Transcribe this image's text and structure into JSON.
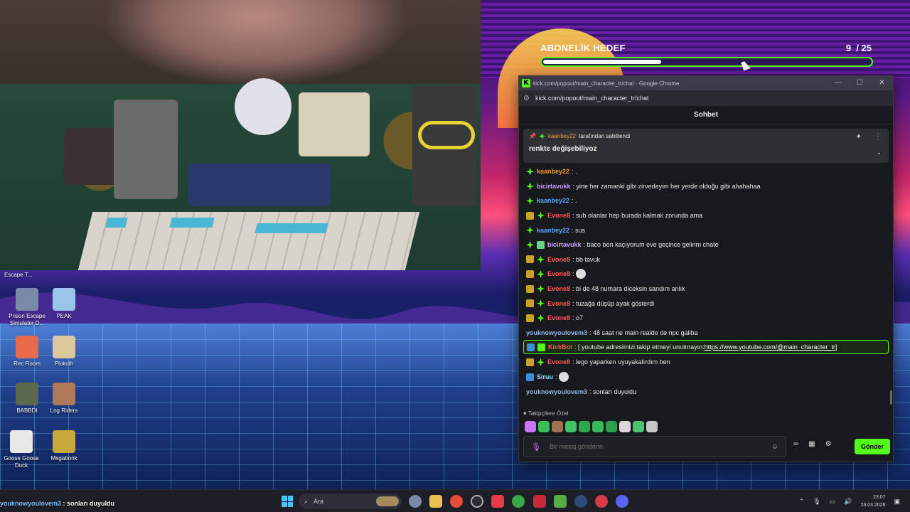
{
  "goal": {
    "title": "ABONELİK HEDEF",
    "current": "9",
    "total": "/ 25",
    "progress": 0.36
  },
  "desktop": {
    "top_label": "Escape T...",
    "icons": [
      {
        "label": "Prison Escape Simulator D...",
        "color": "#7a8aa8"
      },
      {
        "label": "PEAK",
        "color": "#9ac4e8"
      },
      {
        "label": "Rec Room",
        "color": "#e86a4a"
      },
      {
        "label": "Plokoth",
        "color": "#d8c89a"
      },
      {
        "label": "BABBDI",
        "color": "#5a6a4a"
      },
      {
        "label": "Log Riders",
        "color": "#b07a5a"
      },
      {
        "label": "Goose Goose Duck",
        "color": "#e8e8e8"
      },
      {
        "label": "Megabonk",
        "color": "#c8a83a"
      }
    ]
  },
  "window": {
    "title": "kick.com/popout/main_character_tr/chat - Google Chrome",
    "url": "kick.com/popout/main_character_tr/chat",
    "minimize": "—",
    "maximize": "☐",
    "close": "✕"
  },
  "chat": {
    "header": "Sohbet",
    "pinned": {
      "by_user": "kaanbey22",
      "by_text": "tarafından sabitlendi",
      "message": "renkte değişebiliyoz"
    },
    "messages": [
      {
        "user": "kaanbey22",
        "text": ": .",
        "color": "#f29a38",
        "badges": [
          "sub"
        ]
      },
      {
        "user": "bicirtavukk",
        "text": ": yine her zamanki gibi zirvedeyim her yerde olduğu gibi ahahahaa",
        "color": "#c9a0ff",
        "badges": [
          "sub"
        ]
      },
      {
        "user": "kaanbey22",
        "text": ": .",
        "color": "#5aa9ff",
        "badges": [
          "sub"
        ]
      },
      {
        "user": "Evone8",
        "text": ": sub olanlar hep burada kalmak zorunda ama",
        "color": "#ff5a5a",
        "badges": [
          "crown",
          "sub"
        ]
      },
      {
        "user": "kaanbey22",
        "text": ": sus",
        "color": "#5aa9ff",
        "badges": [
          "sub"
        ]
      },
      {
        "user": "bicirtavukk",
        "text": ": baco ben kaçıyorum eve geçince gelirim chate",
        "color": "#c9a0ff",
        "badges": [
          "sub",
          "trash"
        ]
      },
      {
        "user": "Evone8",
        "text": ": bb tavuk",
        "color": "#ff5a5a",
        "badges": [
          "crown",
          "sub"
        ]
      },
      {
        "user": "Evone8",
        "text": ":",
        "color": "#ff5a5a",
        "badges": [
          "crown",
          "sub"
        ],
        "emote": true
      },
      {
        "user": "Evone8",
        "text": ": bi de 48 numara diceksin sandım anlık",
        "color": "#ff5a5a",
        "badges": [
          "crown",
          "sub"
        ]
      },
      {
        "user": "Evone8",
        "text": ": tuzağa düşüp ayak gösterdi",
        "color": "#ff5a5a",
        "badges": [
          "crown",
          "sub"
        ]
      },
      {
        "user": "Evone8",
        "text": ": o7",
        "color": "#ff5a5a",
        "badges": [
          "crown",
          "sub"
        ]
      },
      {
        "user": "youknowyoulovem3",
        "text": ": 48 saat ne main realde de npc galiba",
        "color": "#8fb7e8",
        "badges": []
      },
      {
        "user": "KickBot",
        "text": ": [ youtube adresimizi takip etmeyi unutmayın: ",
        "link": "https://www.youtube.com/@main_character_tr",
        "after": " ]",
        "color": "#ff5a5a",
        "badges": [
          "bot",
          "verified"
        ],
        "highlight": true
      },
      {
        "user": "Evone8",
        "text": ": lego yaparken uyuyakalırdım ben",
        "color": "#ff5a5a",
        "badges": [
          "crown",
          "sub"
        ]
      },
      {
        "user": "Siruu",
        "text": ":",
        "color": "#8fe0ff",
        "badges": [
          "bot"
        ],
        "emote": true
      },
      {
        "user": "youknowyoulovem3",
        "text": ": sonları duyuldu",
        "color": "#8fb7e8",
        "badges": []
      }
    ],
    "followers_only": "Takipçilere Özel",
    "input_placeholder": "Bir mesaj gönderin",
    "send_label": "Gönder"
  },
  "caption": {
    "user": "youknowyoulovem3",
    "text": " : sonları duyuldu"
  },
  "taskbar": {
    "search_placeholder": "Ara",
    "time": "23:07",
    "date": "23.03.2026"
  }
}
